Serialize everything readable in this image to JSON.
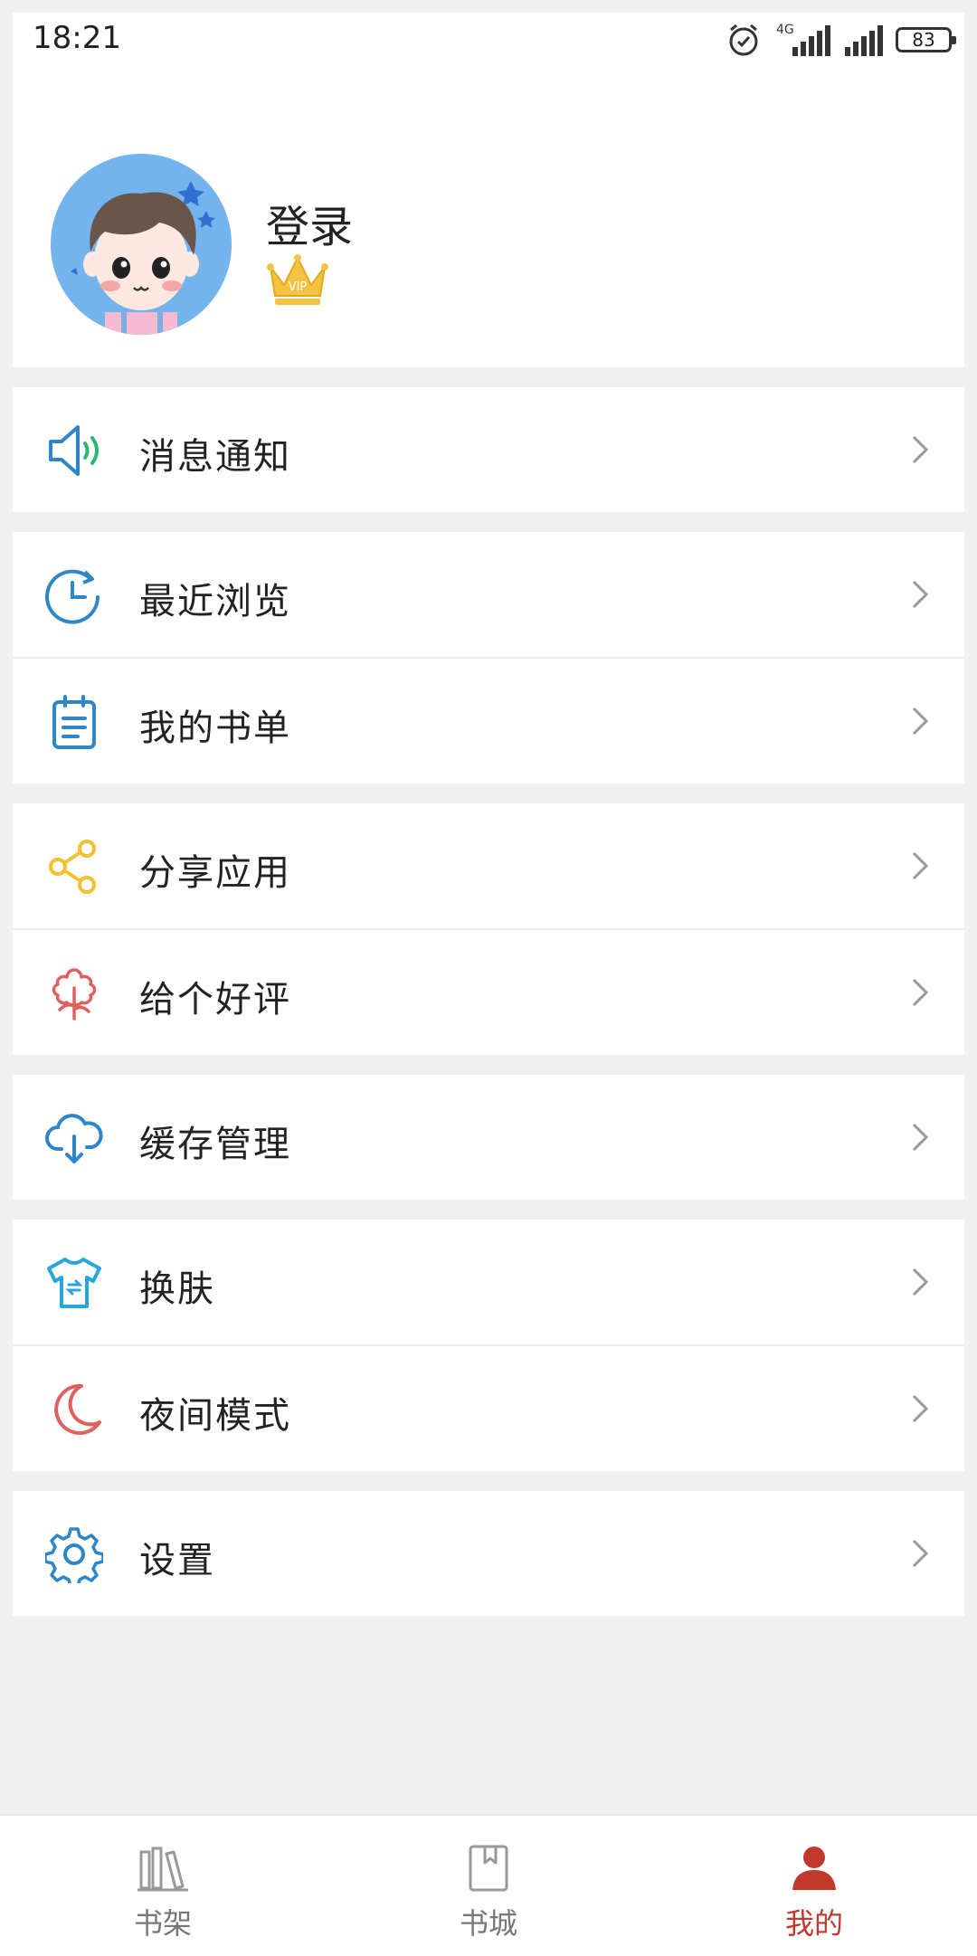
{
  "status_bar": {
    "time": "18:21",
    "network_label": "4G",
    "battery": "83",
    "icons": [
      "alarm-icon",
      "signal-4g-icon",
      "signal-icon",
      "battery-icon"
    ]
  },
  "profile": {
    "login_label": "登录",
    "vip_label": "VIP",
    "avatar_icon": "avatar-cartoon-boy"
  },
  "menu_groups": [
    {
      "items": [
        {
          "label": "消息通知",
          "icon": "speaker-icon"
        }
      ]
    },
    {
      "items": [
        {
          "label": "最近浏览",
          "icon": "history-clock-icon"
        },
        {
          "label": "我的书单",
          "icon": "notepad-icon"
        }
      ]
    },
    {
      "items": [
        {
          "label": "分享应用",
          "icon": "share-icon"
        },
        {
          "label": "给个好评",
          "icon": "flower-icon"
        }
      ]
    },
    {
      "items": [
        {
          "label": "缓存管理",
          "icon": "cloud-download-icon"
        }
      ]
    },
    {
      "items": [
        {
          "label": "换肤",
          "icon": "tshirt-icon"
        },
        {
          "label": "夜间模式",
          "icon": "moon-icon"
        }
      ]
    },
    {
      "items": [
        {
          "label": "设置",
          "icon": "gear-icon"
        }
      ]
    }
  ],
  "tabbar": {
    "tabs": [
      {
        "label": "书架",
        "icon": "bookshelf-icon",
        "active": false
      },
      {
        "label": "书城",
        "icon": "book-icon",
        "active": false
      },
      {
        "label": "我的",
        "icon": "user-icon",
        "active": true
      }
    ]
  },
  "colors": {
    "accent_active": "#c0392b",
    "icon_blue": "#2e86c9",
    "icon_yellow": "#f2c12e",
    "icon_red": "#e06060",
    "icon_green": "#2bb673",
    "icon_cyan": "#26a6d9"
  }
}
